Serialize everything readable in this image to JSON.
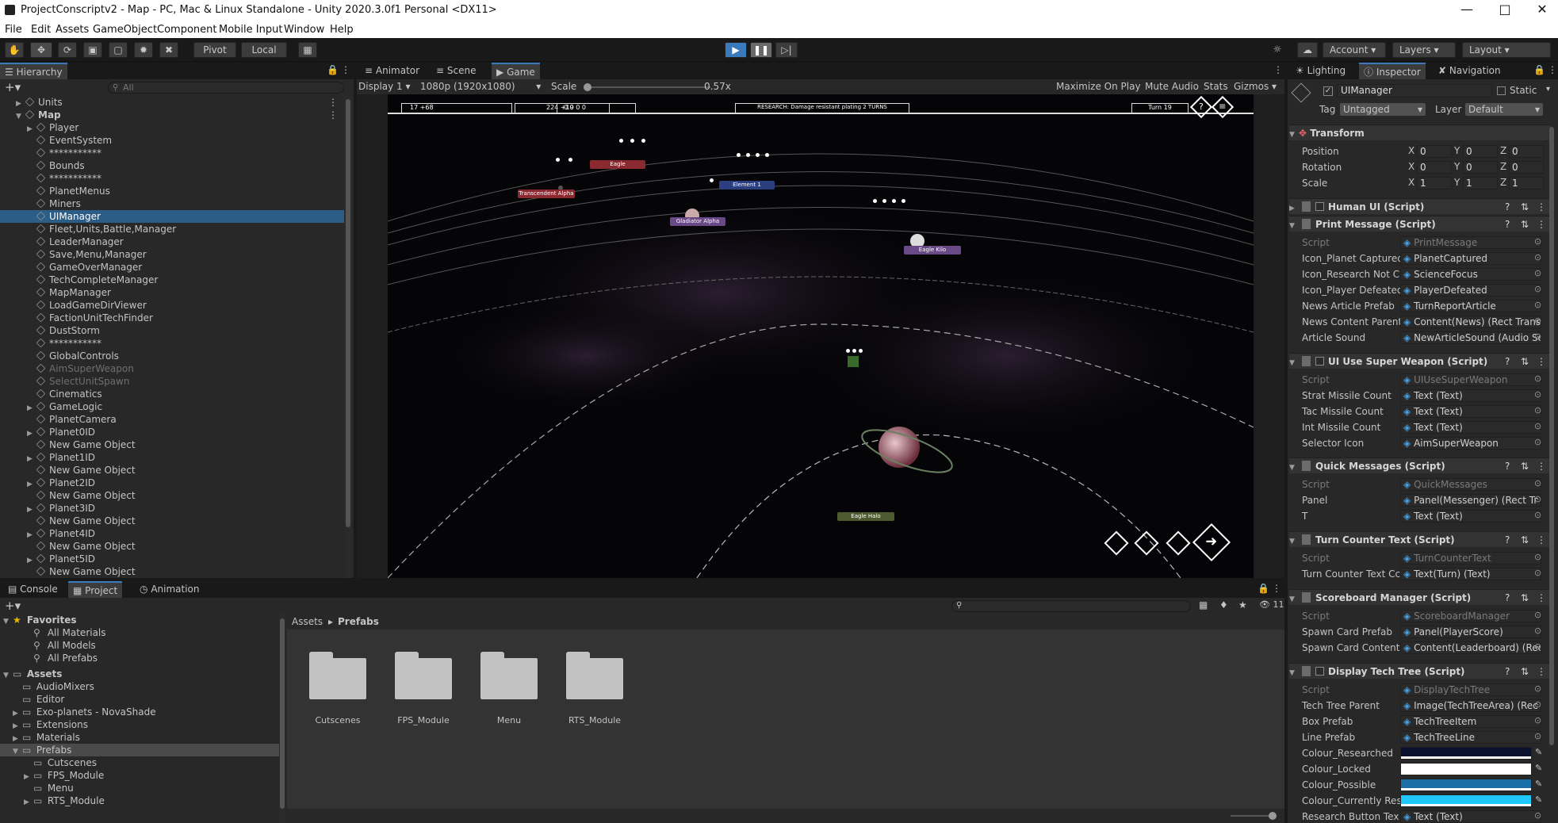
{
  "window": {
    "title": "ProjectConscriptv2 - Map - PC, Mac & Linux Standalone - Unity 2020.3.0f1 Personal <DX11>"
  },
  "menu": [
    "File",
    "Edit",
    "Assets",
    "GameObject",
    "Component",
    "Mobile Input",
    "Window",
    "Help"
  ],
  "toolbar": {
    "pivot": "Pivot",
    "local": "Local",
    "account": "Account",
    "layers": "Layers",
    "layout": "Layout"
  },
  "hierarchy": {
    "tab": "Hierarchy",
    "search_placeholder": "All",
    "items": [
      {
        "label": "Units"
      },
      {
        "label": "Map"
      },
      {
        "label": "Player"
      },
      {
        "label": "EventSystem"
      },
      {
        "label": "***********"
      },
      {
        "label": "Bounds"
      },
      {
        "label": "***********"
      },
      {
        "label": "PlanetMenus"
      },
      {
        "label": "Miners"
      },
      {
        "label": "UIManager"
      },
      {
        "label": "Fleet,Units,Battle,Manager"
      },
      {
        "label": "LeaderManager"
      },
      {
        "label": "Save,Menu,Manager"
      },
      {
        "label": "GameOverManager"
      },
      {
        "label": "TechCompleteManager"
      },
      {
        "label": "MapManager"
      },
      {
        "label": "LoadGameDirViewer"
      },
      {
        "label": "FactionUnitTechFinder"
      },
      {
        "label": "DustStorm"
      },
      {
        "label": "***********"
      },
      {
        "label": "GlobalControls"
      },
      {
        "label": "AimSuperWeapon"
      },
      {
        "label": "SelectUnitSpawn"
      },
      {
        "label": "Cinematics"
      },
      {
        "label": "GameLogic"
      },
      {
        "label": "PlanetCamera"
      },
      {
        "label": "Planet0ID"
      },
      {
        "label": "New Game Object"
      },
      {
        "label": "Planet1ID"
      },
      {
        "label": "New Game Object"
      },
      {
        "label": "Planet2ID"
      },
      {
        "label": "New Game Object"
      },
      {
        "label": "Planet3ID"
      },
      {
        "label": "New Game Object"
      },
      {
        "label": "Planet4ID"
      },
      {
        "label": "New Game Object"
      },
      {
        "label": "Planet5ID"
      },
      {
        "label": "New Game Object"
      }
    ]
  },
  "game_view": {
    "tabs": [
      "Animator",
      "Scene",
      "Game"
    ],
    "display": "Display 1",
    "resolution": "1080p (1920x1080)",
    "scale_label": "Scale",
    "scale_value": "0.57x",
    "options": [
      "Maximize On Play",
      "Mute Audio",
      "Stats",
      "Gizmos"
    ],
    "hud": {
      "resources": "17 +68",
      "ships": "224 +19",
      "stats": "0  0  0  0",
      "research": "RESEARCH: Damage resistant plating 2 TURNS",
      "turn": "Turn 19"
    },
    "planets": [
      "Transcendent Alpha",
      "Eagle",
      "Element 1",
      "Gladiator Alpha",
      "Eagle Kilo",
      "Eagle Halo"
    ]
  },
  "bottom": {
    "tabs": [
      "Console",
      "Project",
      "Animation"
    ],
    "favorites_label": "Favorites",
    "favorites": [
      "All Materials",
      "All Models",
      "All Prefabs"
    ],
    "assets_label": "Assets",
    "assets": [
      "AudioMixers",
      "Editor",
      "Exo-planets - NovaShade",
      "Extensions",
      "Materials",
      "Prefabs",
      "Cutscenes",
      "FPS_Module",
      "Menu",
      "RTS_Module"
    ],
    "breadcrumb": [
      "Assets",
      "Prefabs"
    ],
    "folders": [
      "Cutscenes",
      "FPS_Module",
      "Menu",
      "RTS_Module"
    ],
    "count": "11"
  },
  "inspector": {
    "tabs": [
      "Lighting",
      "Inspector",
      "Navigation"
    ],
    "object_name": "UIManager",
    "static_label": "Static",
    "tag_label": "Tag",
    "tag": "Untagged",
    "layer_label": "Layer",
    "layer": "Default",
    "transform": {
      "title": "Transform",
      "position": "Position",
      "rotation": "Rotation",
      "scale": "Scale",
      "pos": [
        "0",
        "0",
        "0"
      ],
      "rot": [
        "0",
        "0",
        "0"
      ],
      "scl": [
        "1",
        "1",
        "1"
      ]
    },
    "components": [
      {
        "title": "Human UI (Script)",
        "rows": []
      },
      {
        "title": "Print Message (Script)",
        "rows": [
          [
            "Script",
            "PrintMessage"
          ],
          [
            "Icon_Planet Captured",
            "PlanetCaptured"
          ],
          [
            "Icon_Research Not Cl",
            "ScienceFocus"
          ],
          [
            "Icon_Player Defeated",
            "PlayerDefeated"
          ],
          [
            "News Article Prefab",
            "TurnReportArticle"
          ],
          [
            "News Content Parent",
            "Content(News) (Rect Trans"
          ],
          [
            "Article Sound",
            "NewArticleSound (Audio Sc"
          ]
        ]
      },
      {
        "title": "UI Use Super Weapon (Script)",
        "rows": [
          [
            "Script",
            "UIUseSuperWeapon"
          ],
          [
            "Strat Missile Count",
            "Text (Text)"
          ],
          [
            "Tac Missile Count",
            "Text (Text)"
          ],
          [
            "Int Missile Count",
            "Text (Text)"
          ],
          [
            "Selector Icon",
            "AimSuperWeapon"
          ]
        ]
      },
      {
        "title": "Quick Messages (Script)",
        "rows": [
          [
            "Script",
            "QuickMessages"
          ],
          [
            "Panel",
            "Panel(Messenger) (Rect Tr"
          ],
          [
            "T",
            "Text (Text)"
          ]
        ]
      },
      {
        "title": "Turn Counter Text (Script)",
        "rows": [
          [
            "Script",
            "TurnCounterText"
          ],
          [
            "Turn Counter Text Cc",
            "Text(Turn) (Text)"
          ]
        ]
      },
      {
        "title": "Scoreboard Manager (Script)",
        "rows": [
          [
            "Script",
            "ScoreboardManager"
          ],
          [
            "Spawn Card Prefab",
            "Panel(PlayerScore)"
          ],
          [
            "Spawn Card Content",
            "Content(Leaderboard) (Rec"
          ]
        ]
      },
      {
        "title": "Display Tech Tree (Script)",
        "rows": [
          [
            "Script",
            "DisplayTechTree"
          ],
          [
            "Tech Tree Parent",
            "Image(TechTreeArea) (Rec"
          ],
          [
            "Box Prefab",
            "TechTreeItem"
          ],
          [
            "Line Prefab",
            "TechTreeLine"
          ],
          [
            "Colour_Researched",
            ""
          ],
          [
            "Colour_Locked",
            ""
          ],
          [
            "Colour_Possible",
            ""
          ],
          [
            "Colour_Currently Res",
            ""
          ],
          [
            "Research Button Tex",
            "Text (Text)"
          ]
        ]
      }
    ],
    "colours": {
      "researched": "#0b1230",
      "locked": "#ffffff",
      "possible": "#1a6fa8",
      "current": "#1ec8ff"
    }
  }
}
